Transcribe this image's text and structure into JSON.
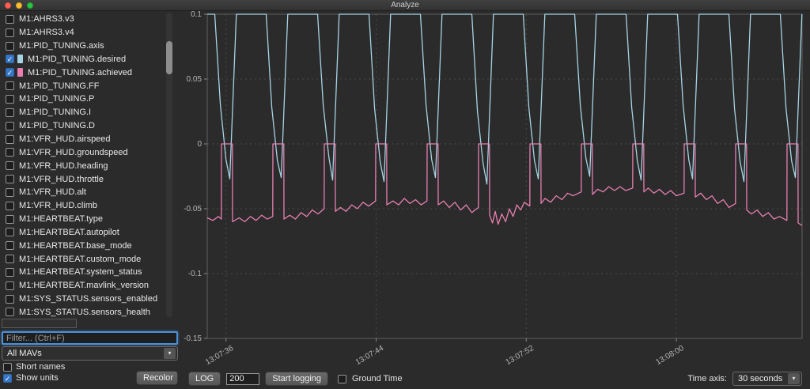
{
  "window": {
    "title": "Analyze"
  },
  "sidebar": {
    "items": [
      {
        "label": "M1:AHRS3.v3",
        "checked": false
      },
      {
        "label": "M1:AHRS3.v4",
        "checked": false
      },
      {
        "label": "M1:PID_TUNING.axis",
        "checked": false
      },
      {
        "label": "M1:PID_TUNING.desired",
        "checked": true,
        "swatch": "#a6d4e4"
      },
      {
        "label": "M1:PID_TUNING.achieved",
        "checked": true,
        "swatch": "#e87fb0"
      },
      {
        "label": "M1:PID_TUNING.FF",
        "checked": false
      },
      {
        "label": "M1:PID_TUNING.P",
        "checked": false
      },
      {
        "label": "M1:PID_TUNING.I",
        "checked": false
      },
      {
        "label": "M1:PID_TUNING.D",
        "checked": false
      },
      {
        "label": "M1:VFR_HUD.airspeed",
        "checked": false
      },
      {
        "label": "M1:VFR_HUD.groundspeed",
        "checked": false
      },
      {
        "label": "M1:VFR_HUD.heading",
        "checked": false
      },
      {
        "label": "M1:VFR_HUD.throttle",
        "checked": false
      },
      {
        "label": "M1:VFR_HUD.alt",
        "checked": false
      },
      {
        "label": "M1:VFR_HUD.climb",
        "checked": false
      },
      {
        "label": "M1:HEARTBEAT.type",
        "checked": false
      },
      {
        "label": "M1:HEARTBEAT.autopilot",
        "checked": false
      },
      {
        "label": "M1:HEARTBEAT.base_mode",
        "checked": false
      },
      {
        "label": "M1:HEARTBEAT.custom_mode",
        "checked": false
      },
      {
        "label": "M1:HEARTBEAT.system_status",
        "checked": false
      },
      {
        "label": "M1:HEARTBEAT.mavlink_version",
        "checked": false
      },
      {
        "label": "M1:SYS_STATUS.sensors_enabled",
        "checked": false
      },
      {
        "label": "M1:SYS_STATUS.sensors_health",
        "checked": false
      }
    ],
    "filter_placeholder": "Filter... (Ctrl+F)",
    "mav_selector": "All MAVs",
    "short_names_label": "Short names",
    "short_names_checked": false,
    "show_units_label": "Show units",
    "show_units_checked": true,
    "recolor_label": "Recolor"
  },
  "bottom_bar": {
    "log_label": "LOG",
    "log_count": "200",
    "start_logging_label": "Start logging",
    "ground_time_label": "Ground Time",
    "ground_time_checked": false,
    "time_axis_label": "Time axis:",
    "time_axis_value": "30 seconds"
  },
  "colors": {
    "desired_series": "#a6d4e4",
    "achieved_series": "#e87fb0",
    "accent_blue": "#4a90d9",
    "background": "#2b2b2b"
  },
  "chart_data": {
    "type": "line",
    "title": "",
    "xlabel": "",
    "ylabel": "",
    "grid": true,
    "legend_position": "none",
    "x_axis": {
      "range_seconds": [
        0,
        31.7
      ],
      "ticks": [
        {
          "t": 1,
          "label": "13:07:36"
        },
        {
          "t": 9,
          "label": "13:07:44"
        },
        {
          "t": 17,
          "label": "13:07:52"
        },
        {
          "t": 25,
          "label": "13:08:00"
        }
      ]
    },
    "y_axis": {
      "range": [
        -0.15,
        0.1
      ],
      "ticks": [
        0.1,
        0.05,
        0,
        -0.05,
        -0.1,
        -0.15
      ]
    },
    "series": [
      {
        "name": "M1:PID_TUNING.desired",
        "color": "#a6d4e4",
        "points": [
          [
            0,
            0.1
          ],
          [
            0.4,
            0.1
          ],
          [
            0.7,
            0.03
          ],
          [
            1.0,
            -0.012
          ],
          [
            1.2,
            -0.027
          ],
          [
            1.55,
            0.1
          ],
          [
            3.14,
            0.1
          ],
          [
            3.44,
            0.028
          ],
          [
            3.74,
            -0.013
          ],
          [
            3.94,
            -0.026
          ],
          [
            4.29,
            0.1
          ],
          [
            5.88,
            0.1
          ],
          [
            6.18,
            0.03
          ],
          [
            6.48,
            -0.01
          ],
          [
            6.68,
            -0.028
          ],
          [
            7.03,
            0.1
          ],
          [
            8.62,
            0.1
          ],
          [
            8.92,
            0.027
          ],
          [
            9.22,
            -0.014
          ],
          [
            9.42,
            -0.029
          ],
          [
            9.77,
            0.1
          ],
          [
            11.36,
            0.1
          ],
          [
            11.66,
            0.03
          ],
          [
            11.96,
            -0.012
          ],
          [
            12.16,
            -0.026
          ],
          [
            12.51,
            0.1
          ],
          [
            14.1,
            0.1
          ],
          [
            14.4,
            0.025
          ],
          [
            14.7,
            -0.015
          ],
          [
            14.9,
            -0.031
          ],
          [
            15.25,
            0.1
          ],
          [
            16.84,
            0.1
          ],
          [
            17.14,
            0.028
          ],
          [
            17.44,
            -0.013
          ],
          [
            17.64,
            -0.027
          ],
          [
            17.99,
            0.1
          ],
          [
            19.58,
            0.1
          ],
          [
            19.88,
            0.03
          ],
          [
            20.18,
            -0.011
          ],
          [
            20.38,
            -0.025
          ],
          [
            20.73,
            0.1
          ],
          [
            22.32,
            0.1
          ],
          [
            22.62,
            0.028
          ],
          [
            22.92,
            -0.013
          ],
          [
            23.12,
            -0.028
          ],
          [
            23.47,
            0.1
          ],
          [
            25.06,
            0.1
          ],
          [
            25.36,
            0.03
          ],
          [
            25.66,
            -0.012
          ],
          [
            25.86,
            -0.027
          ],
          [
            26.21,
            0.1
          ],
          [
            27.8,
            0.1
          ],
          [
            28.1,
            0.027
          ],
          [
            28.4,
            -0.014
          ],
          [
            28.6,
            -0.029
          ],
          [
            28.95,
            0.1
          ],
          [
            30.54,
            0.1
          ],
          [
            30.84,
            0.028
          ],
          [
            31.14,
            -0.013
          ],
          [
            31.34,
            -0.026
          ],
          [
            31.69,
            0.1
          ]
        ]
      },
      {
        "name": "M1:PID_TUNING.achieved",
        "color": "#e87fb0",
        "points": [
          [
            0,
            -0.057
          ],
          [
            0.3,
            -0.059
          ],
          [
            0.6,
            -0.056
          ],
          [
            0.75,
            -0.058
          ],
          [
            0.76,
            0
          ],
          [
            1.34,
            0
          ],
          [
            1.35,
            -0.06
          ],
          [
            1.7,
            -0.057
          ],
          [
            2.0,
            -0.06
          ],
          [
            2.3,
            -0.056
          ],
          [
            2.6,
            -0.059
          ],
          [
            2.9,
            -0.055
          ],
          [
            3.2,
            -0.058
          ],
          [
            3.49,
            -0.056
          ],
          [
            3.5,
            0
          ],
          [
            4.08,
            0
          ],
          [
            4.09,
            -0.058
          ],
          [
            4.4,
            -0.055
          ],
          [
            4.7,
            -0.058
          ],
          [
            5.0,
            -0.053
          ],
          [
            5.3,
            -0.056
          ],
          [
            5.6,
            -0.051
          ],
          [
            5.9,
            -0.054
          ],
          [
            6.23,
            -0.05
          ],
          [
            6.24,
            0
          ],
          [
            6.82,
            0
          ],
          [
            6.83,
            -0.052
          ],
          [
            7.1,
            -0.049
          ],
          [
            7.4,
            -0.052
          ],
          [
            7.7,
            -0.047
          ],
          [
            8.0,
            -0.05
          ],
          [
            8.3,
            -0.045
          ],
          [
            8.6,
            -0.048
          ],
          [
            8.97,
            -0.044
          ],
          [
            8.98,
            0
          ],
          [
            9.56,
            0
          ],
          [
            9.57,
            -0.047
          ],
          [
            9.9,
            -0.044
          ],
          [
            10.2,
            -0.047
          ],
          [
            10.5,
            -0.042
          ],
          [
            10.8,
            -0.046
          ],
          [
            11.1,
            -0.043
          ],
          [
            11.4,
            -0.047
          ],
          [
            11.71,
            -0.044
          ],
          [
            11.72,
            0
          ],
          [
            12.3,
            0
          ],
          [
            12.31,
            -0.047
          ],
          [
            12.6,
            -0.044
          ],
          [
            12.9,
            -0.049
          ],
          [
            13.2,
            -0.045
          ],
          [
            13.5,
            -0.051
          ],
          [
            13.8,
            -0.047
          ],
          [
            14.1,
            -0.053
          ],
          [
            14.45,
            -0.049
          ],
          [
            14.46,
            0
          ],
          [
            15.04,
            0
          ],
          [
            15.05,
            -0.055
          ],
          [
            15.2,
            -0.061
          ],
          [
            15.35,
            -0.052
          ],
          [
            15.5,
            -0.062
          ],
          [
            15.7,
            -0.054
          ],
          [
            15.9,
            -0.06
          ],
          [
            16.1,
            -0.05
          ],
          [
            16.3,
            -0.056
          ],
          [
            16.5,
            -0.047
          ],
          [
            16.7,
            -0.051
          ],
          [
            16.9,
            -0.045
          ],
          [
            17.19,
            -0.048
          ],
          [
            17.2,
            0
          ],
          [
            17.78,
            0
          ],
          [
            17.79,
            -0.046
          ],
          [
            18.0,
            -0.042
          ],
          [
            18.3,
            -0.045
          ],
          [
            18.6,
            -0.04
          ],
          [
            18.9,
            -0.043
          ],
          [
            19.2,
            -0.038
          ],
          [
            19.5,
            -0.04
          ],
          [
            19.93,
            -0.037
          ],
          [
            19.94,
            0
          ],
          [
            20.52,
            0
          ],
          [
            20.53,
            -0.039
          ],
          [
            20.8,
            -0.035
          ],
          [
            21.1,
            -0.037
          ],
          [
            21.4,
            -0.033
          ],
          [
            21.7,
            -0.036
          ],
          [
            22.0,
            -0.033
          ],
          [
            22.3,
            -0.036
          ],
          [
            22.67,
            -0.034
          ],
          [
            22.68,
            0
          ],
          [
            23.26,
            0
          ],
          [
            23.27,
            -0.037
          ],
          [
            23.5,
            -0.034
          ],
          [
            23.8,
            -0.038
          ],
          [
            24.1,
            -0.035
          ],
          [
            24.4,
            -0.039
          ],
          [
            24.7,
            -0.036
          ],
          [
            25.0,
            -0.04
          ],
          [
            25.41,
            -0.038
          ],
          [
            25.42,
            0
          ],
          [
            26.0,
            0
          ],
          [
            26.01,
            -0.041
          ],
          [
            26.3,
            -0.038
          ],
          [
            26.6,
            -0.043
          ],
          [
            26.9,
            -0.04
          ],
          [
            27.2,
            -0.046
          ],
          [
            27.5,
            -0.043
          ],
          [
            27.8,
            -0.049
          ],
          [
            28.15,
            -0.046
          ],
          [
            28.16,
            0
          ],
          [
            28.74,
            0
          ],
          [
            28.75,
            -0.051
          ],
          [
            29.0,
            -0.054
          ],
          [
            29.3,
            -0.051
          ],
          [
            29.6,
            -0.056
          ],
          [
            29.9,
            -0.053
          ],
          [
            30.2,
            -0.058
          ],
          [
            30.5,
            -0.056
          ],
          [
            30.89,
            -0.059
          ],
          [
            30.9,
            0
          ],
          [
            31.48,
            0
          ],
          [
            31.49,
            -0.061
          ],
          [
            31.7,
            -0.063
          ]
        ]
      }
    ]
  }
}
